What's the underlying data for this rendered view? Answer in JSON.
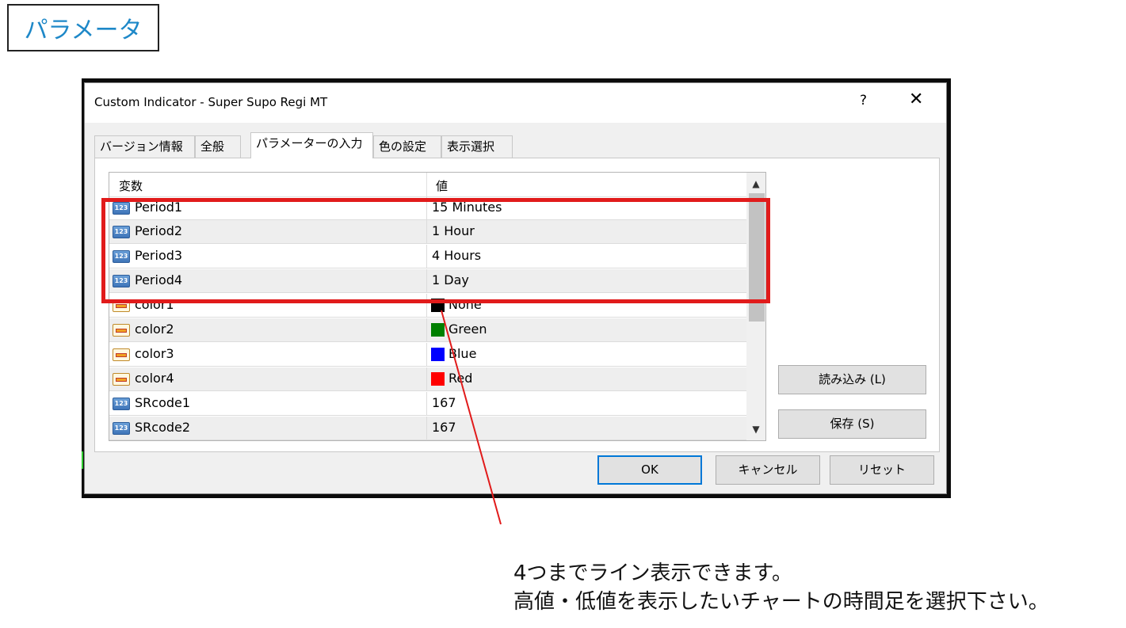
{
  "heading": "パラメータ",
  "dialog": {
    "title": "Custom Indicator - Super Supo Regi MT",
    "help": "?",
    "close": "✕",
    "tabs": [
      "バージョン情報",
      "全般",
      "パラメーターの入力",
      "色の設定",
      "表示選択"
    ],
    "active_tab": "パラメーターの入力",
    "grid": {
      "headers": [
        "変数",
        "値"
      ],
      "rows": [
        {
          "name": "Period1",
          "value": "15 Minutes",
          "icon": "number-icon"
        },
        {
          "name": "Period2",
          "value": "1 Hour",
          "icon": "number-icon"
        },
        {
          "name": "Period3",
          "value": "4 Hours",
          "icon": "number-icon"
        },
        {
          "name": "Period4",
          "value": "1 Day",
          "icon": "number-icon"
        },
        {
          "name": "color1",
          "value": "None",
          "icon": "color-icon",
          "swatch": "#000000"
        },
        {
          "name": "color2",
          "value": "Green",
          "icon": "color-icon",
          "swatch": "#008000"
        },
        {
          "name": "color3",
          "value": "Blue",
          "icon": "color-icon",
          "swatch": "#0000ff"
        },
        {
          "name": "color4",
          "value": "Red",
          "icon": "color-icon",
          "swatch": "#ff0000"
        },
        {
          "name": "SRcode1",
          "value": "167",
          "icon": "number-icon"
        },
        {
          "name": "SRcode2",
          "value": "167",
          "icon": "number-icon"
        }
      ]
    },
    "buttons": {
      "load": "読み込み (L)",
      "save": "保存 (S)",
      "ok": "OK",
      "cancel": "キャンセル",
      "reset": "リセット"
    }
  },
  "annotation": {
    "line1": "4つまでライン表示できます。",
    "line2": "高値・低値を表示したいチャートの時間足を選択下さい。"
  },
  "colors": {
    "highlight": "#e11b1b",
    "heading_text": "#1e88c8",
    "ok_border": "#0078d7"
  }
}
